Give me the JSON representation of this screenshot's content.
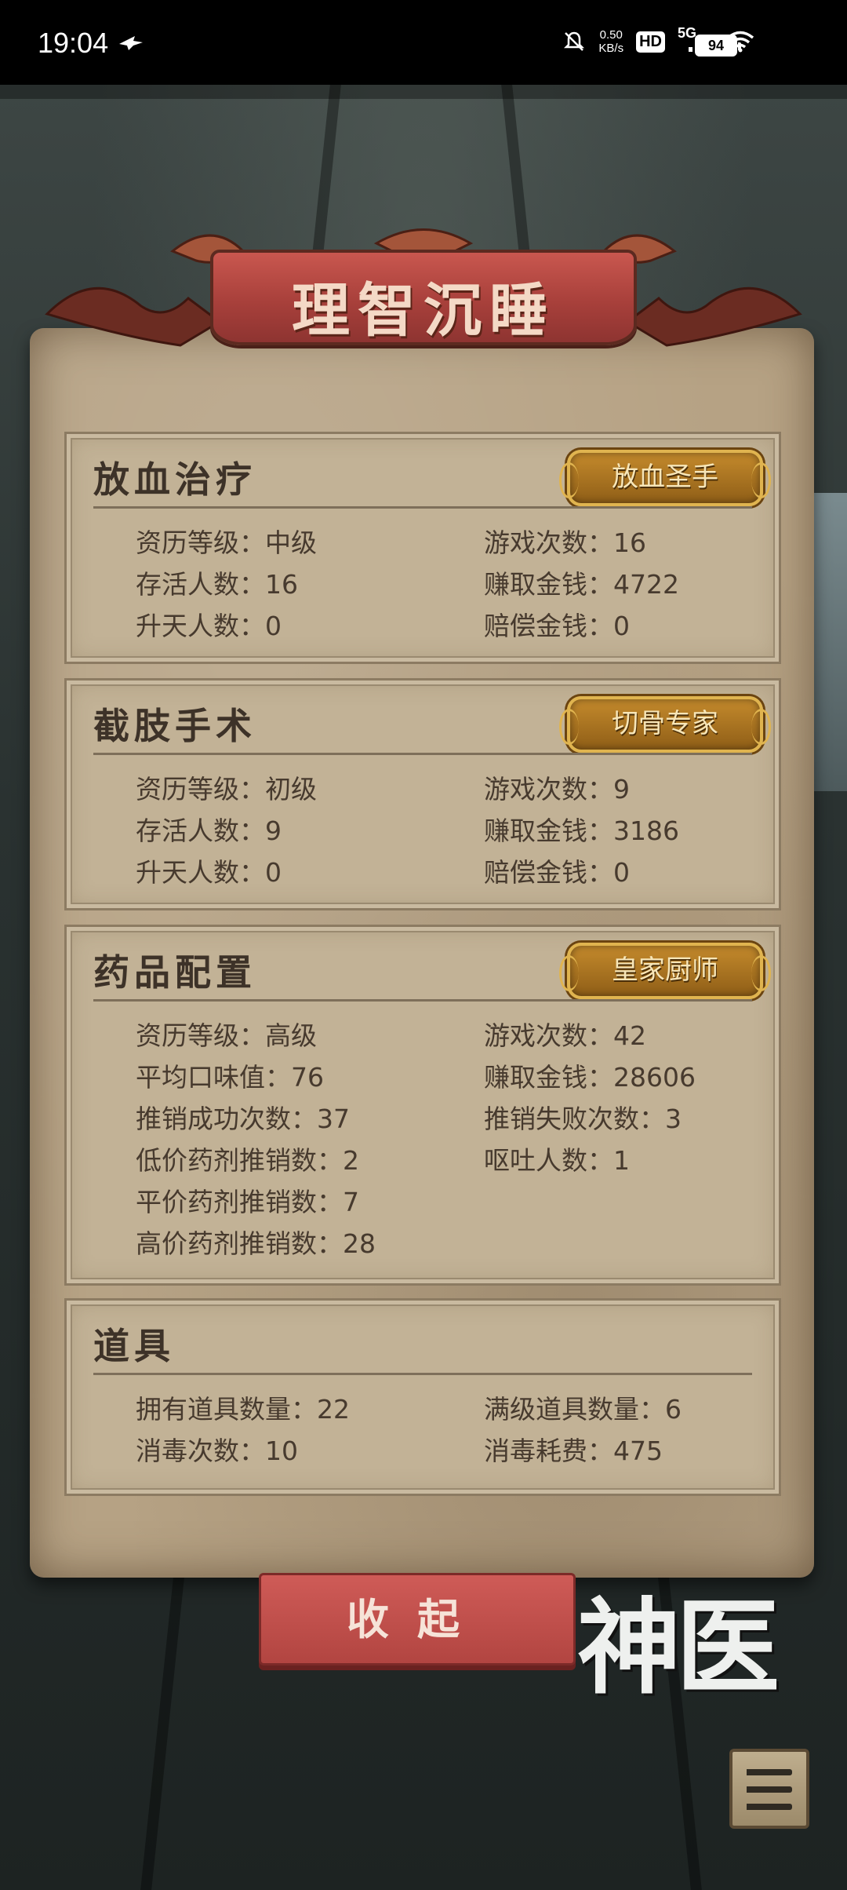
{
  "status_bar": {
    "time": "19:04",
    "speed_value": "0.50",
    "speed_unit": "KB/s",
    "hd": "HD",
    "network": "5G",
    "battery": "94"
  },
  "banner": {
    "title": "理智沉睡"
  },
  "sections": [
    {
      "title": "放血治疗",
      "badge": "放血圣手",
      "left": [
        "资历等级：中级",
        "存活人数：16",
        "升天人数：0"
      ],
      "right": [
        "游戏次数：16",
        "赚取金钱：4722",
        "赔偿金钱：0"
      ]
    },
    {
      "title": "截肢手术",
      "badge": "切骨专家",
      "left": [
        "资历等级：初级",
        "存活人数：9",
        "升天人数：0"
      ],
      "right": [
        "游戏次数：9",
        "赚取金钱：3186",
        "赔偿金钱：0"
      ]
    },
    {
      "title": "药品配置",
      "badge": "皇家厨师",
      "left": [
        "资历等级：高级",
        "平均口味值：76",
        "推销成功次数：37",
        "低价药剂推销数：2",
        "平价药剂推销数：7",
        "高价药剂推销数：28"
      ],
      "right": [
        "游戏次数：42",
        "赚取金钱：28606",
        "推销失败次数：3",
        "呕吐人数：1"
      ]
    },
    {
      "title": "道具",
      "left": [
        "拥有道具数量：22",
        "消毒次数：10"
      ],
      "right": [
        "满级道具数量：6",
        "消毒耗费：475"
      ]
    }
  ],
  "collapse_button": "收起",
  "logo_text": "神医"
}
